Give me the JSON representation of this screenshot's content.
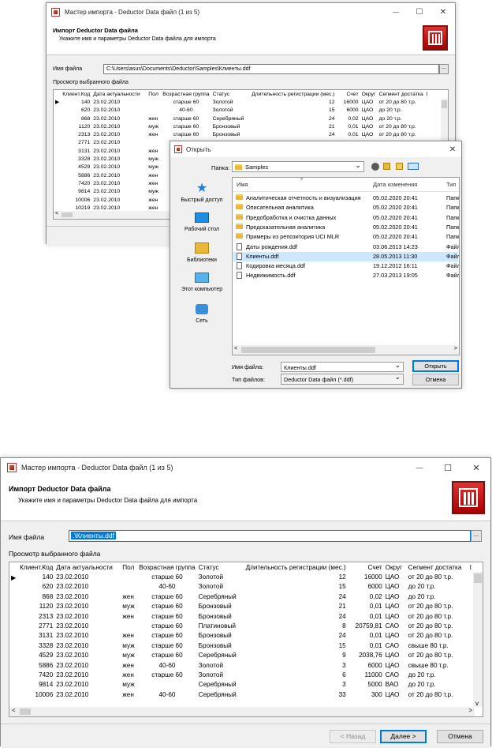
{
  "wizard": {
    "window_title": "Мастер импорта - Deductor Data файл (1 из 5)",
    "header_title": "Импорт Deductor Data файла",
    "header_subtitle": "Укажите имя и параметры Deductor Data файла для импорта",
    "filename_label": "Имя файла",
    "filename_value_top": "C:\\Users\\asus\\Documents\\Deductor\\Samples\\Клиенты.ddf",
    "filename_value_bottom": ".\\Клиенты.ddf",
    "browse_label": "...",
    "preview_label": "Просмотр выбранного файла",
    "columns": [
      "Клиент.Код",
      "Дата актуальности",
      "Пол",
      "Возрастная группа",
      "Статус",
      "Длительность регистрации (мес.)",
      "Счет",
      "Округ",
      "Сегмент достатка",
      "I"
    ],
    "rows_top": [
      [
        "140",
        "23.02.2010",
        "",
        "старше 60",
        "Золотой",
        "12",
        "16000",
        "ЦАО",
        "от 20 до 80 т.р."
      ],
      [
        "620",
        "23.02.2010",
        "",
        "40-60",
        "Золотой",
        "15",
        "6000",
        "ЦАО",
        "до 20 т.р."
      ],
      [
        "868",
        "23.02.2010",
        "жен",
        "старше 60",
        "Серебряный",
        "24",
        "0,02",
        "ЦАО",
        "до 20 т.р."
      ],
      [
        "1120",
        "23.02.2010",
        "муж",
        "старше 60",
        "Бронзовый",
        "21",
        "0,01",
        "ЦАО",
        "от 20 до 80 т.р."
      ],
      [
        "2313",
        "23.02.2010",
        "жен",
        "старше 60",
        "Бронзовый",
        "24",
        "0,01",
        "ЦАО",
        "от 20 до 80 т.р."
      ],
      [
        "2771",
        "23.02.2010",
        "",
        "стс",
        "",
        "",
        "",
        "",
        ""
      ],
      [
        "3131",
        "23.02.2010",
        "жен",
        "стс",
        "",
        "",
        "",
        "",
        ""
      ],
      [
        "3328",
        "23.02.2010",
        "муж",
        "стс",
        "",
        "",
        "",
        "",
        ""
      ],
      [
        "4529",
        "23.02.2010",
        "муж",
        "стс",
        "",
        "",
        "",
        "",
        ""
      ],
      [
        "5886",
        "23.02.2010",
        "жен",
        "40-",
        "",
        "",
        "",
        "",
        ""
      ],
      [
        "7420",
        "23.02.2010",
        "жен",
        "стс",
        "",
        "",
        "",
        "",
        ""
      ],
      [
        "9814",
        "23.02.2010",
        "муж",
        "",
        "",
        "",
        "",
        "",
        ""
      ],
      [
        "10006",
        "23.02.2010",
        "жен",
        "40-",
        "",
        "",
        "",
        "",
        ""
      ],
      [
        "10219",
        "23.02.2010",
        "жен",
        "стс",
        "",
        "",
        "",
        "",
        ""
      ]
    ],
    "rows_bottom": [
      [
        "140",
        "23.02.2010",
        "",
        "старше 60",
        "Золотой",
        "12",
        "16000",
        "ЦАО",
        "от 20 до 80 т.р."
      ],
      [
        "620",
        "23.02.2010",
        "",
        "40-60",
        "Золотой",
        "15",
        "6000",
        "ЦАО",
        "до 20 т.р."
      ],
      [
        "868",
        "23.02.2010",
        "жен",
        "старше 60",
        "Серебряный",
        "24",
        "0,02",
        "ЦАО",
        "до 20 т.р."
      ],
      [
        "1120",
        "23.02.2010",
        "муж",
        "старше 60",
        "Бронзовый",
        "21",
        "0,01",
        "ЦАО",
        "от 20 до 80 т.р."
      ],
      [
        "2313",
        "23.02.2010",
        "жен",
        "старше 60",
        "Бронзовый",
        "24",
        "0,01",
        "ЦАО",
        "от 20 до 80 т.р."
      ],
      [
        "2771",
        "23.02.2010",
        "",
        "старше 60",
        "Платиновый",
        "8",
        "20759,81",
        "САО",
        "от 20 до 80 т.р."
      ],
      [
        "3131",
        "23.02.2010",
        "жен",
        "старше 60",
        "Бронзовый",
        "24",
        "0,01",
        "ЦАО",
        "от 20 до 80 т.р."
      ],
      [
        "3328",
        "23.02.2010",
        "муж",
        "старше 60",
        "Бронзовый",
        "15",
        "0,01",
        "САО",
        "свыше 80 т.р."
      ],
      [
        "4529",
        "23.02.2010",
        "муж",
        "старше 60",
        "Серебряный",
        "9",
        "2038,76",
        "ЦАО",
        "от 20 до 80 т.р."
      ],
      [
        "5886",
        "23.02.2010",
        "жен",
        "40-60",
        "Золотой",
        "3",
        "6000",
        "ЦАО",
        "свыше 80 т.р."
      ],
      [
        "7420",
        "23.02.2010",
        "жен",
        "старше 60",
        "Золотой",
        "6",
        "11000",
        "САО",
        "до 20 т.р."
      ],
      [
        "9814",
        "23.02.2010",
        "муж",
        "",
        "Серебряный",
        "3",
        "5000",
        "ВАО",
        "до 20 т.р."
      ],
      [
        "10006",
        "23.02.2010",
        "жен",
        "40-60",
        "Серебряный",
        "33",
        "300",
        "ЦАО",
        "от 20 до 80 т.р."
      ]
    ],
    "back_label": "< Назад",
    "next_label": "Далее >",
    "cancel_label": "Отмена",
    "close_glyph": "✕",
    "minimize_glyph": "—",
    "maximize_glyph": "☐",
    "row_marker": "▶",
    "arrow_left": "<",
    "arrow_right": ">",
    "arrow_up": "^",
    "arrow_down": "v"
  },
  "open_dialog": {
    "title": "Открыть",
    "folder_label": "Папка:",
    "folder_value": "Samples",
    "places": [
      "Быстрый доступ",
      "Рабочий стол",
      "Библиотеки",
      "Этот компьютер",
      "Сеть"
    ],
    "col_name": "Имя",
    "col_modified": "Дата изменения",
    "col_type": "Тип",
    "sort_caret": "^",
    "files": [
      {
        "name": "Аналитическая отчетность и визуализация",
        "date": "05.02.2020 20:41",
        "type": "Папк",
        "kind": "folder"
      },
      {
        "name": "Описательная аналитика",
        "date": "05.02.2020 20:41",
        "type": "Папк",
        "kind": "folder"
      },
      {
        "name": "Предобработка и очистка данных",
        "date": "05.02.2020 20:41",
        "type": "Папк",
        "kind": "folder"
      },
      {
        "name": "Предсказательная аналитика",
        "date": "05.02.2020 20:41",
        "type": "Папк",
        "kind": "folder"
      },
      {
        "name": "Примеры из репозитория UCI MLR",
        "date": "05.02.2020 20:41",
        "type": "Папк",
        "kind": "folder"
      },
      {
        "name": "Даты рождения.ddf",
        "date": "03.06.2013 14:23",
        "type": "Файл",
        "kind": "file"
      },
      {
        "name": "Клиенты.ddf",
        "date": "28.05.2013 11:30",
        "type": "Файл",
        "kind": "file"
      },
      {
        "name": "Кодировка месяца.ddf",
        "date": "19.12.2012 16:11",
        "type": "Файл",
        "kind": "file"
      },
      {
        "name": "Недвижимость.ddf",
        "date": "27.03.2013 19:05",
        "type": "Файл",
        "kind": "file"
      }
    ],
    "selected_index": 6,
    "filename_label": "Имя файла:",
    "filename_value": "Клиенты.ddf",
    "filetype_label": "Тип файлов:",
    "filetype_value": "Deductor Data файл (*.ddf)",
    "open_label": "Открыть",
    "cancel_label": "Отмена",
    "close_glyph": "✕",
    "dropdown_glyph": "⌄"
  }
}
